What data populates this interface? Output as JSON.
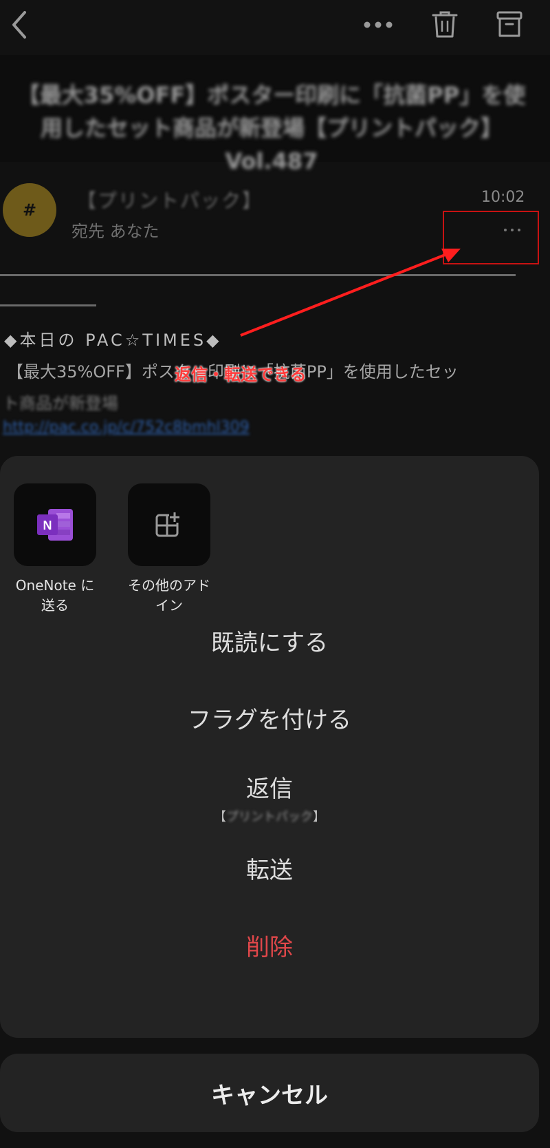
{
  "nav": {
    "back_icon": "chevron-left-icon",
    "more_icon": "more-horizontal-icon",
    "delete_icon": "trash-icon",
    "archive_icon": "archive-icon"
  },
  "email": {
    "subject": "【最大35%OFF】ポスター印刷に「抗菌PP」を使用したセット商品が新登場【プリントパック】Vol.487",
    "avatar_initial": "#",
    "sender": "【プリントパック】",
    "recipient": "宛先 あなた",
    "time": "10:02",
    "pac_times": "◆本日の PAC☆TIMES◆",
    "promo_line": "【最大35%OFF】ポスター印刷に「抗菌PP」を使用したセッ",
    "promo_line2": "ト商品が新登場",
    "link": "http://pac.co.jp/c/752c8bmhl309"
  },
  "annotation": {
    "text": "返信・転送できる",
    "color": "#ff1e1e"
  },
  "sheet": {
    "tiles": [
      {
        "label_line1": "OneNote に",
        "label_line2": "送る",
        "icon": "onenote-icon"
      },
      {
        "label_line1": "その他のアド",
        "label_line2": "イン",
        "icon": "add-in-icon"
      }
    ],
    "items": {
      "mark_read": "既読にする",
      "flag": "フラグを付ける",
      "reply": "返信",
      "reply_sub_open": "【",
      "reply_sub_name": "プリントパック",
      "reply_sub_close": "】",
      "forward": "転送",
      "delete": "削除"
    },
    "cancel": "キャンセル"
  },
  "colors": {
    "background": "#111111",
    "sheet": "#232323",
    "delete": "#e0474a",
    "onenote": "#7b2fbe"
  }
}
